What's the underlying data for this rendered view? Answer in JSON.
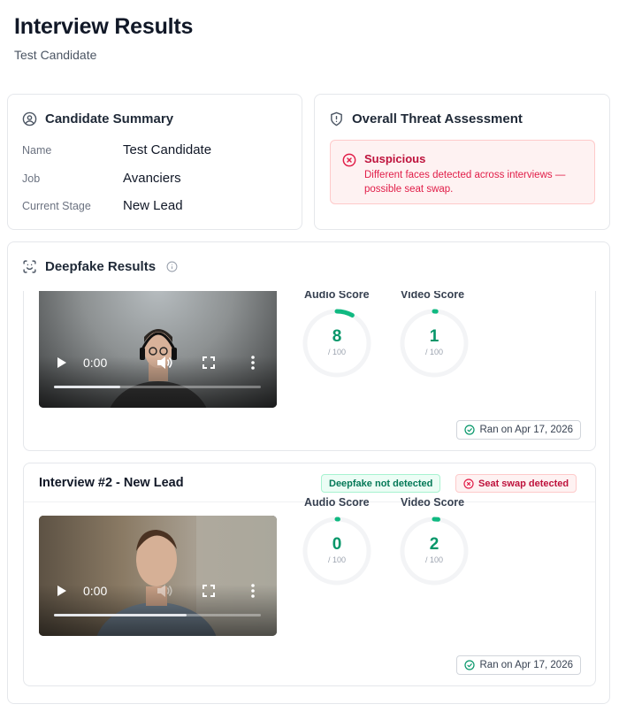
{
  "header": {
    "title": "Interview Results",
    "subtitle": "Test Candidate"
  },
  "summary": {
    "title": "Candidate Summary",
    "icon": "user-circle-icon",
    "fields": [
      {
        "label": "Name",
        "value": "Test Candidate"
      },
      {
        "label": "Job",
        "value": "Avanciers"
      },
      {
        "label": "Current Stage",
        "value": "New Lead"
      }
    ]
  },
  "threat": {
    "title": "Overall Threat Assessment",
    "icon": "shield-icon",
    "status": "Suspicious",
    "message": "Different faces detected across interviews — possible seat swap.",
    "status_color": "#be123c"
  },
  "deepfake": {
    "title": "Deepfake Results",
    "icon": "face-scan-icon",
    "interviews": [
      {
        "title": "",
        "video": {
          "time": "0:00",
          "progress": 0.32
        },
        "audio_label": "Audio Score",
        "audio_score": "8",
        "audio_value": 8,
        "video_label": "Video Score",
        "video_score": "1",
        "video_value": 1,
        "max_label": "/ 100",
        "ran": "Ran on Apr 17, 2026"
      },
      {
        "title": "Interview #2 - New Lead",
        "badges": {
          "deepfake": "Deepfake not detected",
          "seat_swap": "Seat swap detected"
        },
        "video": {
          "time": "0:00",
          "progress": 0.64
        },
        "audio_label": "Audio Score",
        "audio_score": "0",
        "audio_value": 0,
        "video_label": "Video Score",
        "video_score": "2",
        "video_value": 2,
        "max_label": "/ 100",
        "ran": "Ran on Apr 17, 2026"
      }
    ]
  },
  "colors": {
    "score_green": "#10b981",
    "danger": "#e11d48",
    "success": "#047857"
  }
}
